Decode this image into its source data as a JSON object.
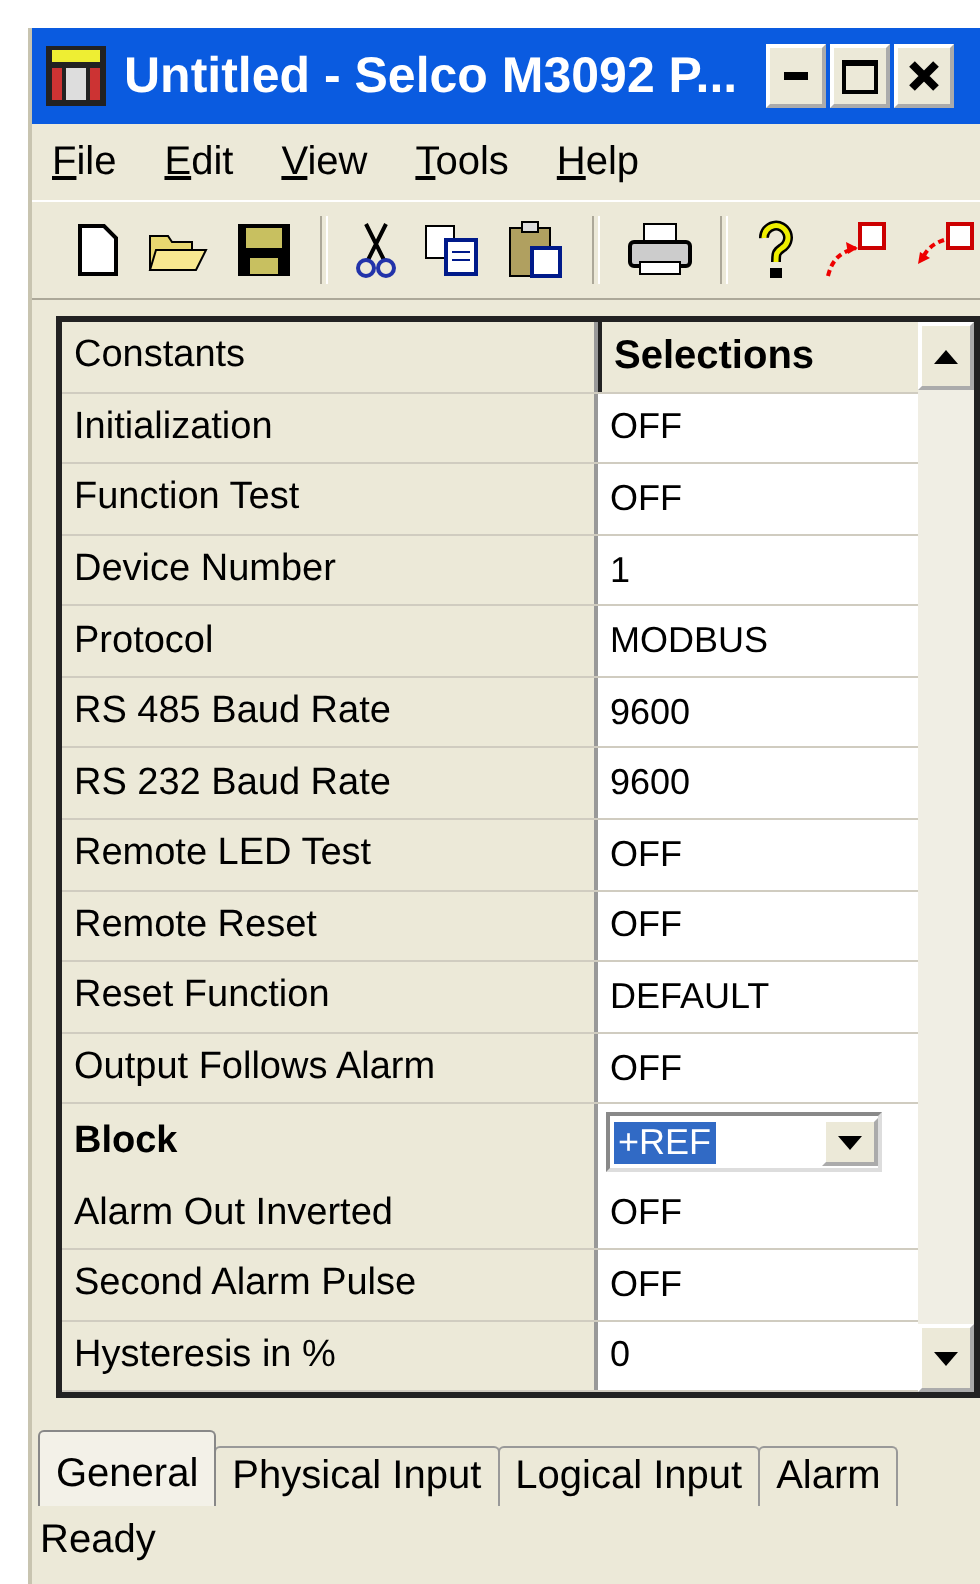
{
  "window": {
    "title": "Untitled - Selco M3092 P..."
  },
  "menu": [
    {
      "mnemonic": "F",
      "rest": "ile"
    },
    {
      "mnemonic": "E",
      "rest": "dit"
    },
    {
      "mnemonic": "V",
      "rest": "iew"
    },
    {
      "mnemonic": "T",
      "rest": "ools"
    },
    {
      "mnemonic": "H",
      "rest": "elp"
    }
  ],
  "toolbar": [
    {
      "kind": "new"
    },
    {
      "kind": "open"
    },
    {
      "kind": "save"
    },
    {
      "kind": "sep"
    },
    {
      "kind": "cut"
    },
    {
      "kind": "copy"
    },
    {
      "kind": "paste"
    },
    {
      "kind": "sep"
    },
    {
      "kind": "print"
    },
    {
      "kind": "sep"
    },
    {
      "kind": "help"
    },
    {
      "kind": "upload"
    },
    {
      "kind": "download"
    }
  ],
  "grid": {
    "columns": [
      "Constants",
      "Selections"
    ],
    "rows": [
      {
        "kind": "setting",
        "name": "Initialization",
        "value": "OFF"
      },
      {
        "kind": "setting",
        "name": "Function Test",
        "value": "OFF"
      },
      {
        "kind": "setting",
        "name": "Device Number",
        "value": "1"
      },
      {
        "kind": "setting",
        "name": "Protocol",
        "value": "MODBUS"
      },
      {
        "kind": "setting",
        "name": "RS 485 Baud Rate",
        "value": "9600"
      },
      {
        "kind": "setting",
        "name": "RS 232 Baud Rate",
        "value": "9600"
      },
      {
        "kind": "setting",
        "name": "Remote LED Test",
        "value": "OFF"
      },
      {
        "kind": "setting",
        "name": "Remote Reset",
        "value": "OFF"
      },
      {
        "kind": "setting",
        "name": "Reset Function",
        "value": "DEFAULT"
      },
      {
        "kind": "setting",
        "name": "Output Follows Alarm",
        "value": "OFF"
      },
      {
        "kind": "combo",
        "name": "Block",
        "value": "+REF"
      },
      {
        "kind": "setting",
        "name": "Alarm Out Inverted",
        "value": "OFF"
      },
      {
        "kind": "setting",
        "name": "Second Alarm Pulse",
        "value": "OFF"
      },
      {
        "kind": "setting",
        "name": "Hysteresis in %",
        "value": "0"
      }
    ]
  },
  "tabs": [
    {
      "label": "General",
      "selected": true
    },
    {
      "label": "Physical Input",
      "selected": false
    },
    {
      "label": "Logical Input",
      "selected": false
    },
    {
      "label": "Alarm",
      "selected": false
    }
  ],
  "status_bar": {
    "text": "Ready"
  }
}
